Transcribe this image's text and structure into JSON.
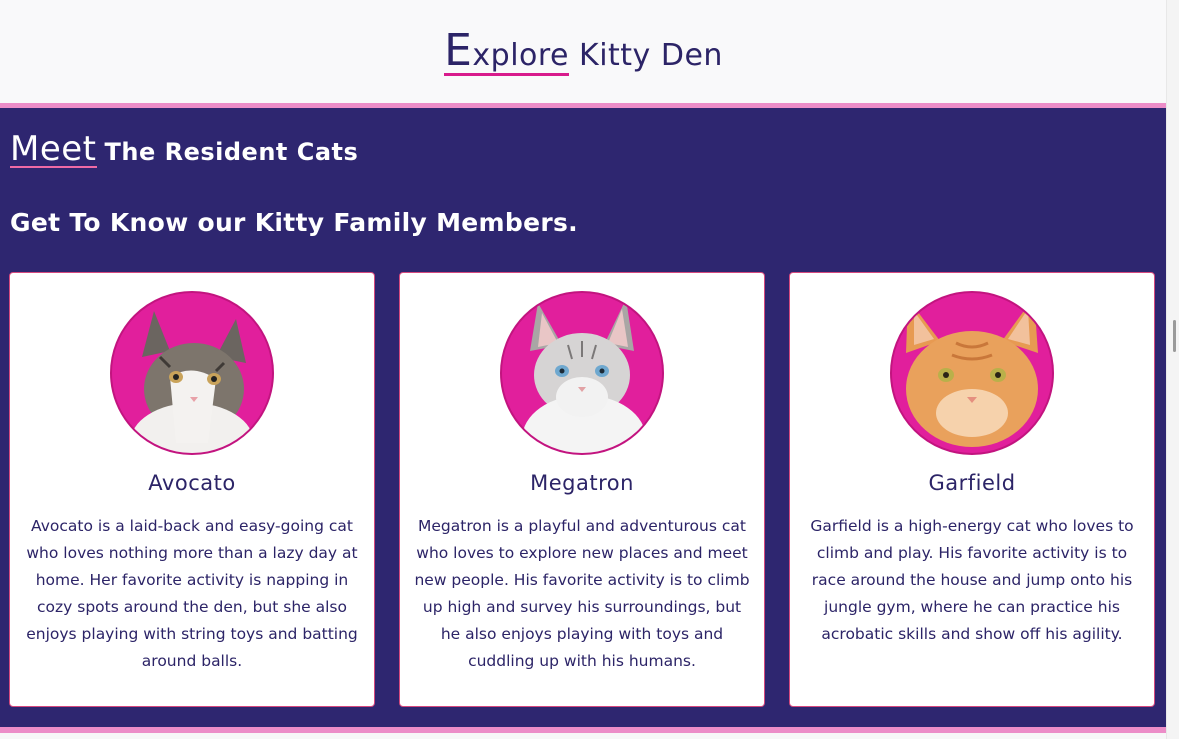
{
  "header": {
    "title_first_big": "E",
    "title_first_rest": "xplore",
    "title_rest": "Kitty Den"
  },
  "section": {
    "heading_first": "Meet",
    "heading_rest": "The Resident Cats",
    "subheading": "Get To Know our Kitty Family Members."
  },
  "cats": [
    {
      "name": "Avocato",
      "description": "Avocato is a laid-back and easy-going cat who loves nothing more than a lazy day at home. Her favorite activity is napping in cozy spots around the den, but she also enjoys playing with string toys and batting around balls."
    },
    {
      "name": "Megatron",
      "description": "Megatron is a playful and adventurous cat who loves to explore new places and meet new people. His favorite activity is to climb up high and survey his surroundings, but he also enjoys playing with toys and cuddling up with his humans."
    },
    {
      "name": "Garfield",
      "description": "Garfield is a high-energy cat who loves to climb and play. His favorite activity is to race around the house and jump onto his jungle gym, where he can practice his acrobatic skills and show off his agility."
    }
  ],
  "colors": {
    "band": "#2e2670",
    "accent_pink": "#ec8dc8",
    "avatar_bg": "#e11f9c",
    "text_navy": "#2c2467"
  }
}
